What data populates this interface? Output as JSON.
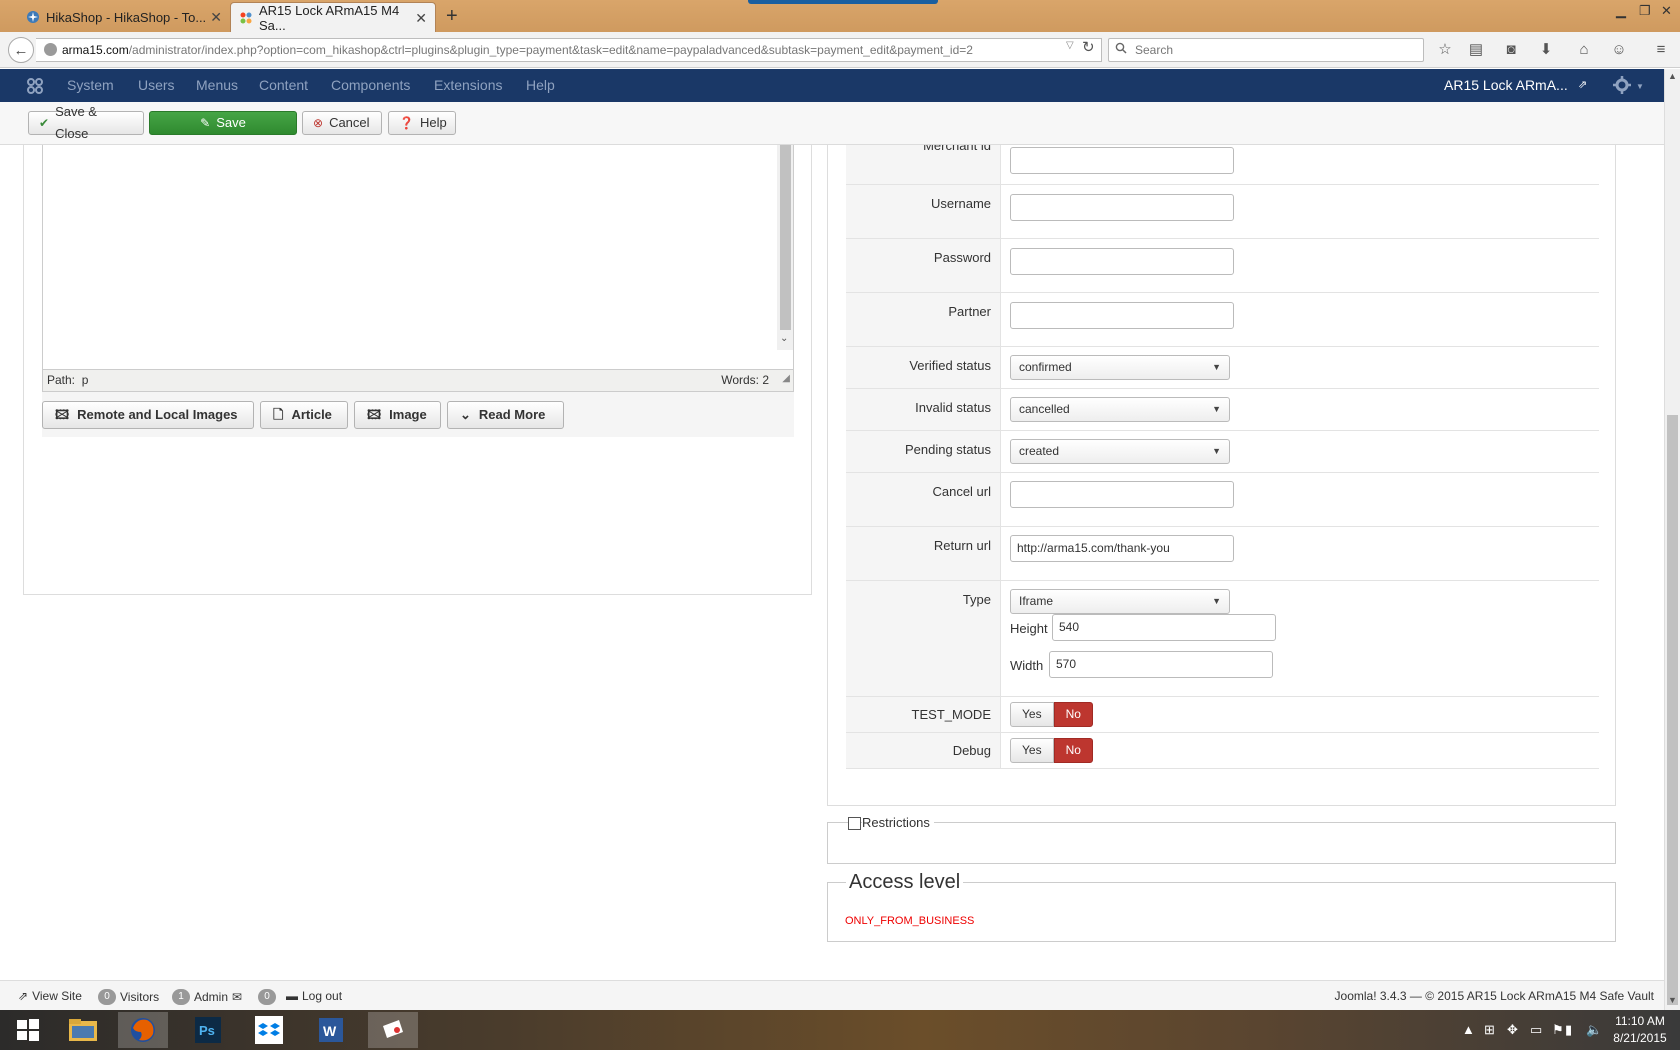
{
  "browser": {
    "tabs": [
      {
        "title": "HikaShop - HikaShop - To..."
      },
      {
        "title": "AR15 Lock ARmA15 M4 Sa..."
      }
    ],
    "url_host": "arma15.com",
    "url_path": "/administrator/index.php?option=com_hikashop&ctrl=plugins&plugin_type=payment&task=edit&name=paypaladvanced&subtask=payment_edit&payment_id=2",
    "search_placeholder": "Search"
  },
  "admin_menu": {
    "items": [
      "System",
      "Users",
      "Menus",
      "Content",
      "Components",
      "Extensions",
      "Help"
    ],
    "site_name": "AR15 Lock ARmA..."
  },
  "toolbar": {
    "save_close": "Save & Close",
    "save": "Save",
    "cancel": "Cancel",
    "help": "Help"
  },
  "editor": {
    "path_label": "Path:",
    "path_value": "p",
    "words": "Words: 2",
    "buttons": [
      "Remote and Local Images",
      "Article",
      "Image",
      "Read More"
    ]
  },
  "params": {
    "merchant_id_label": "Merchant id",
    "username_label": "Username",
    "password_label": "Password",
    "partner_label": "Partner",
    "verified_status_label": "Verified status",
    "verified_status_value": "confirmed",
    "invalid_status_label": "Invalid status",
    "invalid_status_value": "cancelled",
    "pending_status_label": "Pending status",
    "pending_status_value": "created",
    "cancel_url_label": "Cancel url",
    "cancel_url_value": "",
    "return_url_label": "Return url",
    "return_url_value": "http://arma15.com/thank-you",
    "type_label": "Type",
    "type_value": "Iframe",
    "height_label": "Height",
    "height_value": "540",
    "width_label": "Width",
    "width_value": "570",
    "test_mode_label": "TEST_MODE",
    "debug_label": "Debug",
    "yes": "Yes",
    "no": "No"
  },
  "restrictions": {
    "label": "Restrictions"
  },
  "access": {
    "title": "Access level",
    "value": "ONLY_FROM_BUSINESS"
  },
  "statusbar": {
    "view_site": "View Site",
    "visitors_count": "0",
    "visitors": "Visitors",
    "admin_count": "1",
    "admin": "Admin",
    "messages_count": "0",
    "logout": "Log out",
    "footer": "Joomla! 3.4.3 — © 2015 AR15 Lock ARmA15 M4 Safe Vault"
  },
  "taskbar": {
    "time": "11:10 AM",
    "date": "8/21/2015"
  },
  "colors": {
    "joomla_header": "#1a3867",
    "save_green": "#46a546",
    "no_red": "#bd362f",
    "access_red": "#ee0000"
  }
}
